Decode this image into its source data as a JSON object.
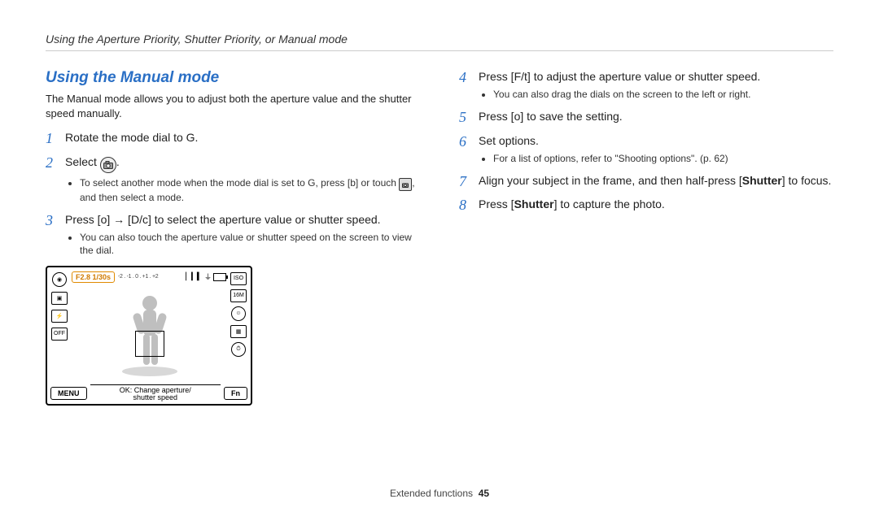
{
  "header": "Using the Aperture Priority, Shutter Priority, or Manual mode",
  "section_title": "Using the Manual mode",
  "lead": "The Manual mode allows you to adjust both the aperture value and the shutter speed manually.",
  "left_steps": [
    {
      "n": "1",
      "body_parts": [
        "Rotate the mode dial to ",
        "G",
        "."
      ]
    },
    {
      "n": "2",
      "body_parts": [
        "Select ",
        " ",
        "."
      ],
      "sub_parts": [
        [
          "To select another mode when the mode dial is set to ",
          "G",
          ", press [",
          "b",
          "] or touch ",
          " ",
          ", and then select a mode."
        ]
      ]
    },
    {
      "n": "3",
      "body_parts": [
        "Press [",
        "o",
        "] → [",
        "D",
        "/",
        "c",
        "] to select the aperture value or shutter speed."
      ],
      "sub_parts": [
        [
          "You can also touch the aperture value or shutter speed on the screen to view the dial."
        ]
      ]
    }
  ],
  "right_steps": [
    {
      "n": "4",
      "body_parts": [
        "Press [",
        "F",
        "/",
        "t",
        "] to adjust the aperture value or shutter speed."
      ],
      "sub_parts": [
        [
          "You can also drag the dials on the screen to the left or right."
        ]
      ]
    },
    {
      "n": "5",
      "body_parts": [
        "Press [",
        "o",
        "] to save the setting."
      ]
    },
    {
      "n": "6",
      "body_parts": [
        "Set options."
      ],
      "sub_parts": [
        [
          "For a list of options, refer to \"Shooting options\". (p. 62)"
        ]
      ]
    },
    {
      "n": "7",
      "body_parts": [
        "Align your subject in the frame, and then half-press [",
        "Shutter",
        "] to focus."
      ]
    },
    {
      "n": "8",
      "body_parts": [
        "Press [",
        "Shutter",
        "] to capture the photo."
      ]
    }
  ],
  "lcd": {
    "exposure": "F2.8 1/30s",
    "ev_scale": "-2 . -1 . 0 . +1 . +2",
    "menu_btn": "MENU",
    "fn_btn": "Fn",
    "caption_line1": "OK: Change aperture/",
    "caption_line2": "shutter speed",
    "left_icons": [
      "mode",
      "drive",
      "flash",
      "off"
    ],
    "right_icons": [
      "iso",
      "res",
      "face",
      "af",
      "timer"
    ],
    "top_right": [
      "wifi",
      "battery"
    ]
  },
  "footer": {
    "label": "Extended functions",
    "page": "45"
  }
}
